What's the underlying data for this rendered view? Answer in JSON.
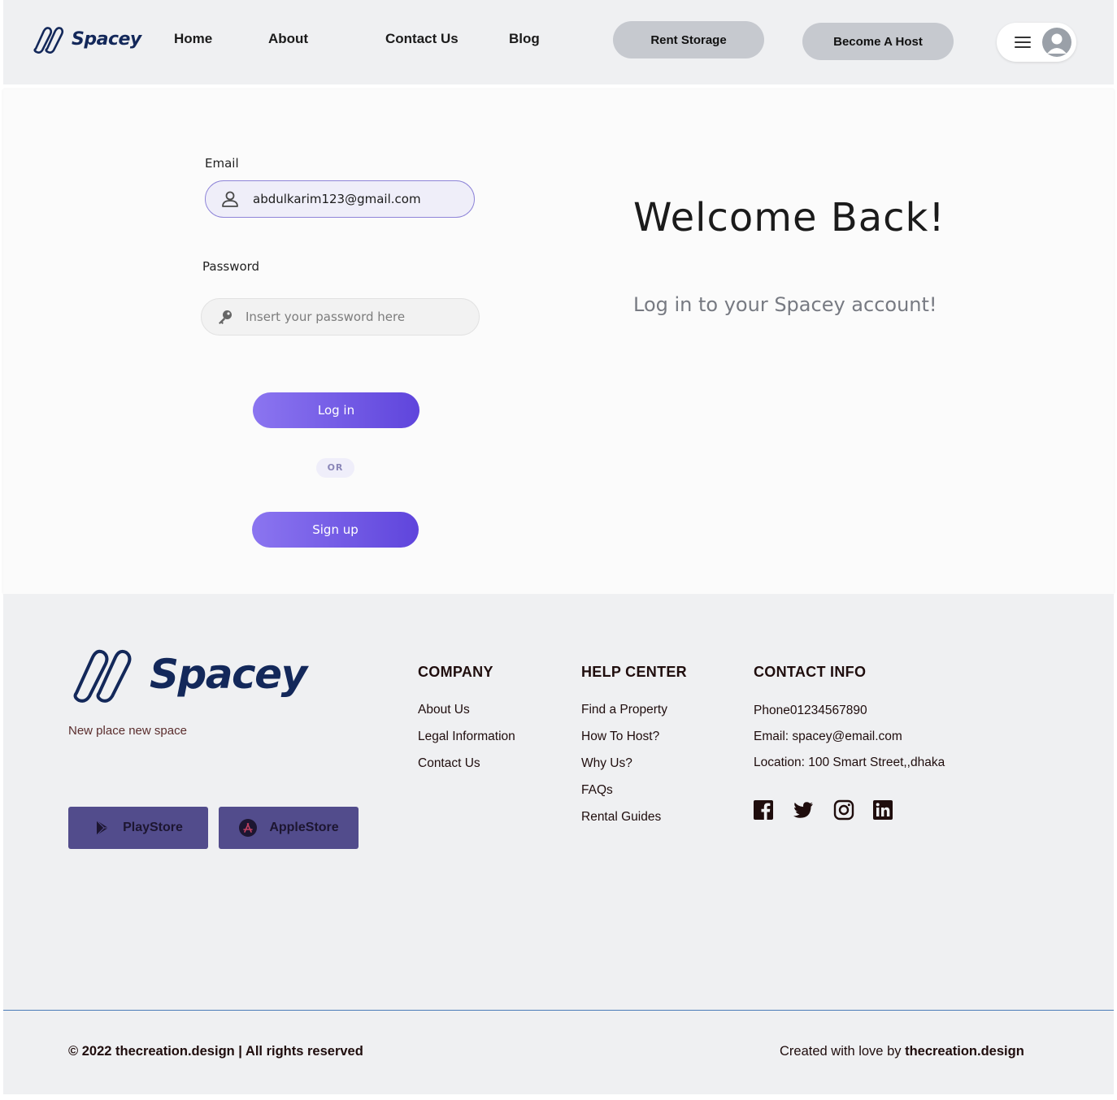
{
  "header": {
    "brand": "Spacey",
    "nav": [
      {
        "label": "Home"
      },
      {
        "label": "About"
      },
      {
        "label": "Contact Us"
      },
      {
        "label": "Blog"
      }
    ],
    "rent_storage_label": "Rent Storage",
    "become_host_label": "Become A Host"
  },
  "login": {
    "email_label": "Email",
    "email_value": "abdulkarim123@gmail.com",
    "password_label": "Password",
    "password_placeholder": "Insert your password here",
    "login_label": "Log in",
    "or_label": "OR",
    "signup_label": "Sign up"
  },
  "welcome": {
    "title": "Welcome Back!",
    "subtitle": "Log in to your Spacey account!"
  },
  "footer": {
    "brand": "Spacey",
    "tagline": "New place new  space",
    "stores": [
      {
        "label": "PlayStore",
        "icon": "play-store-icon"
      },
      {
        "label": "AppleStore",
        "icon": "app-store-icon"
      }
    ],
    "company": {
      "title": "COMPANY",
      "links": [
        "About Us",
        "Legal Information",
        "Contact Us"
      ]
    },
    "help": {
      "title": "HELP CENTER",
      "links": [
        "Find a Property",
        "How To Host?",
        "Why Us?",
        "FAQs",
        "Rental Guides"
      ]
    },
    "contact": {
      "title": "CONTACT INFO",
      "phone": "Phone01234567890",
      "email": "Email: spacey@email.com",
      "location": "Location: 100 Smart Street,,dhaka"
    },
    "social_icons": [
      "facebook-icon",
      "twitter-icon",
      "instagram-icon",
      "linkedin-icon"
    ],
    "copyright": "© 2022 thecreation.design | All rights reserved",
    "credit_prefix": "Created with love by ",
    "credit_brand": "thecreation.design"
  },
  "colors": {
    "brand_navy": "#13285a",
    "accent_start": "#8b75f0",
    "accent_end": "#5f45dc",
    "store_button": "#524c8c",
    "header_bg": "#eff0f2"
  }
}
